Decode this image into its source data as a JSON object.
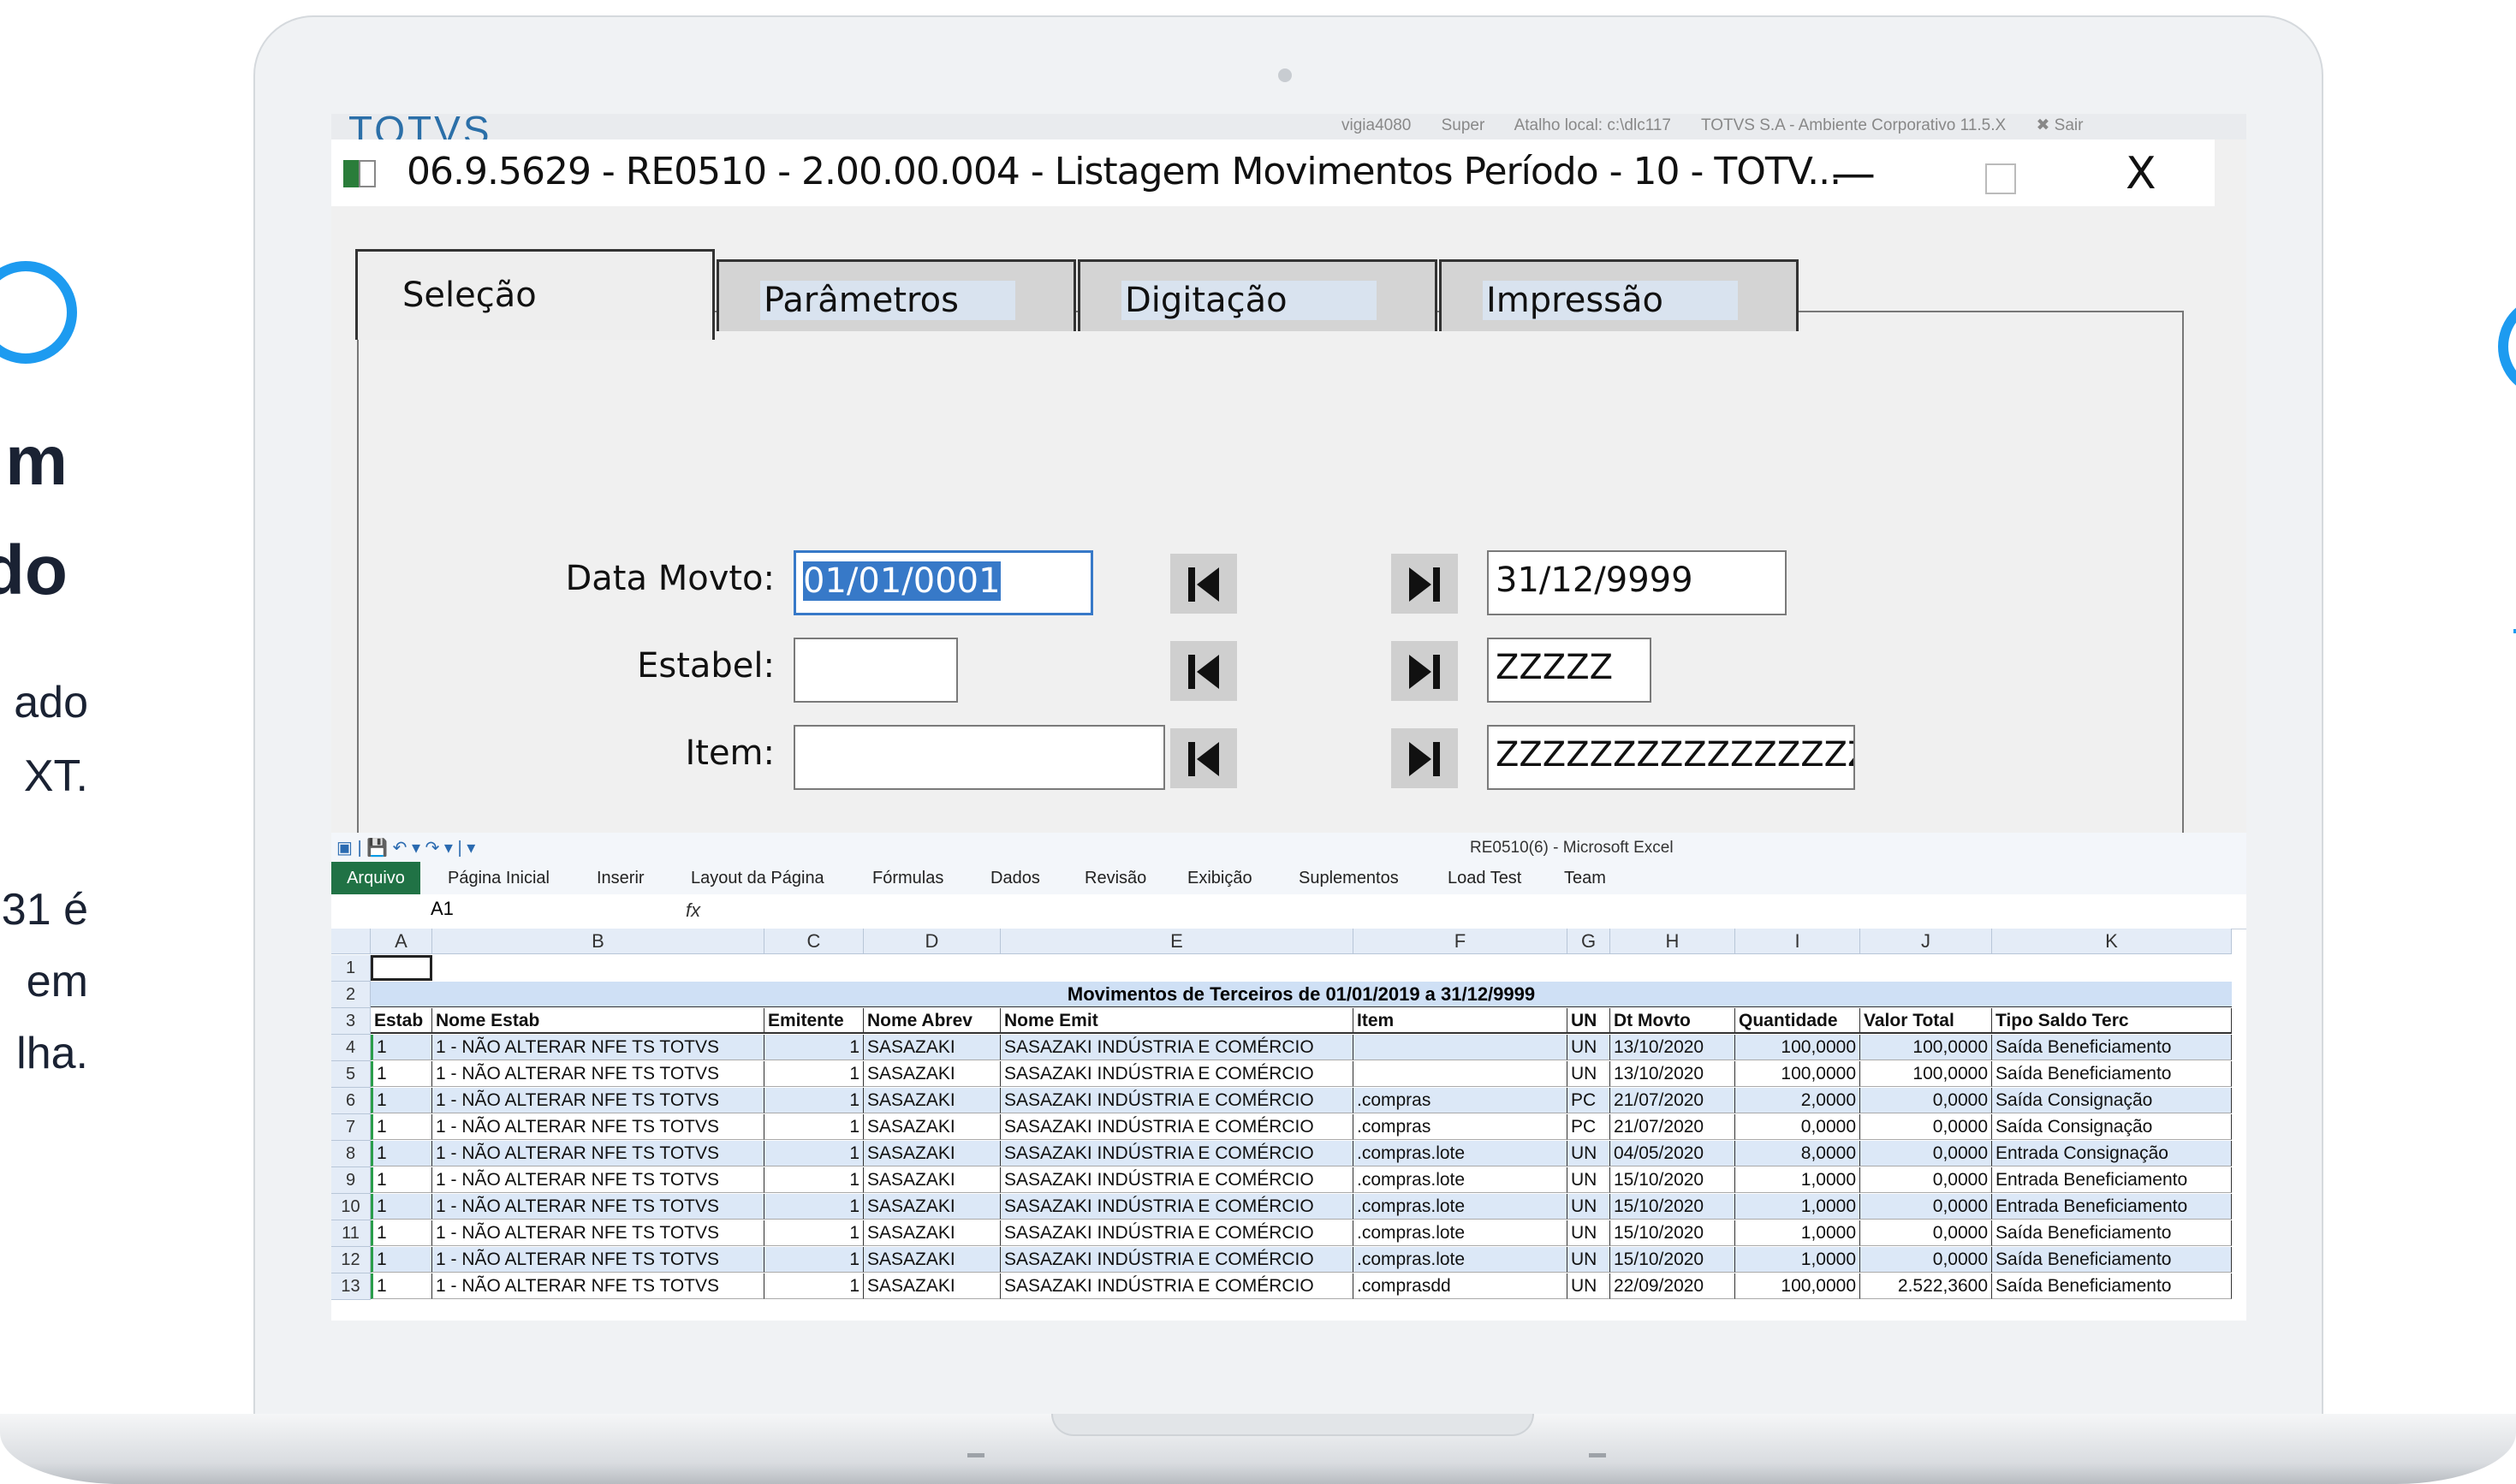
{
  "slide": {
    "left_big": [
      "m",
      "do"
    ],
    "left_small": [
      "ado",
      "XT.",
      "31 é",
      "em",
      "lha."
    ]
  },
  "bg_app": {
    "logo": "TOTVS",
    "topbar": [
      "vigia4080",
      "Super",
      "Atalho local: c:\\dlc117",
      "TOTVS S.A - Ambiente Corporativo 11.5.X",
      "✖ Sair"
    ]
  },
  "window": {
    "title": "06.9.5629 - RE0510 - 2.00.00.004 - Listagem Movimentos Período - 10 - TOTV...",
    "minimize": "—",
    "close": "X"
  },
  "tabs": [
    "Seleção",
    "Parâmetros",
    "Digitação",
    "Impressão"
  ],
  "selection": {
    "rows": [
      {
        "label": "Data Movto:",
        "from": "01/01/0001",
        "to": "31/12/9999"
      },
      {
        "label": "Estabel:",
        "from": "",
        "to": "ZZZZZ"
      },
      {
        "label": "Item:",
        "from": "",
        "to": "ZZZZZZZZZZZZZZZZ"
      }
    ]
  },
  "excel": {
    "title": "RE0510(6) - Microsoft Excel",
    "qat": "▣ | 💾 ↶ ▾ ↷ ▾ | ▾",
    "ribbon_tabs": [
      "Arquivo",
      "Página Inicial",
      "Inserir",
      "Layout da Página",
      "Fórmulas",
      "Dados",
      "Revisão",
      "Exibição",
      "Suplementos",
      "Load Test",
      "Team"
    ],
    "name_box": "A1",
    "fx": "fx",
    "columns": [
      "A",
      "B",
      "C",
      "D",
      "E",
      "F",
      "G",
      "H",
      "I",
      "J",
      "K"
    ],
    "report_title": "Movimentos de Terceiros de 01/01/2019 a 31/12/9999",
    "headers": [
      "Estab",
      "Nome Estab",
      "Emitente",
      "Nome Abrev",
      "Nome Emit",
      "Item",
      "UN",
      "Dt Movto",
      "Quantidade",
      "Valor Total",
      "Tipo Saldo Terc"
    ],
    "rows": [
      [
        "1",
        "1 - NÃO ALTERAR NFE TS TOTVS",
        "1",
        "SASAZAKI",
        "SASAZAKI INDÚSTRIA E COMÉRCIO",
        "",
        "UN",
        "13/10/2020",
        "100,0000",
        "100,0000",
        "Saída Beneficiamento"
      ],
      [
        "1",
        "1 - NÃO ALTERAR NFE TS TOTVS",
        "1",
        "SASAZAKI",
        "SASAZAKI INDÚSTRIA E COMÉRCIO",
        "",
        "UN",
        "13/10/2020",
        "100,0000",
        "100,0000",
        "Saída Beneficiamento"
      ],
      [
        "1",
        "1 - NÃO ALTERAR NFE TS TOTVS",
        "1",
        "SASAZAKI",
        "SASAZAKI INDÚSTRIA E COMÉRCIO",
        ".compras",
        "PC",
        "21/07/2020",
        "2,0000",
        "0,0000",
        "Saída Consignação"
      ],
      [
        "1",
        "1 - NÃO ALTERAR NFE TS TOTVS",
        "1",
        "SASAZAKI",
        "SASAZAKI INDÚSTRIA E COMÉRCIO",
        ".compras",
        "PC",
        "21/07/2020",
        "0,0000",
        "0,0000",
        "Saída Consignação"
      ],
      [
        "1",
        "1 - NÃO ALTERAR NFE TS TOTVS",
        "1",
        "SASAZAKI",
        "SASAZAKI INDÚSTRIA E COMÉRCIO",
        ".compras.lote",
        "UN",
        "04/05/2020",
        "8,0000",
        "0,0000",
        "Entrada Consignação"
      ],
      [
        "1",
        "1 - NÃO ALTERAR NFE TS TOTVS",
        "1",
        "SASAZAKI",
        "SASAZAKI INDÚSTRIA E COMÉRCIO",
        ".compras.lote",
        "UN",
        "15/10/2020",
        "1,0000",
        "0,0000",
        "Entrada Beneficiamento"
      ],
      [
        "1",
        "1 - NÃO ALTERAR NFE TS TOTVS",
        "1",
        "SASAZAKI",
        "SASAZAKI INDÚSTRIA E COMÉRCIO",
        ".compras.lote",
        "UN",
        "15/10/2020",
        "1,0000",
        "0,0000",
        "Entrada Beneficiamento"
      ],
      [
        "1",
        "1 - NÃO ALTERAR NFE TS TOTVS",
        "1",
        "SASAZAKI",
        "SASAZAKI INDÚSTRIA E COMÉRCIO",
        ".compras.lote",
        "UN",
        "15/10/2020",
        "1,0000",
        "0,0000",
        "Saída Beneficiamento"
      ],
      [
        "1",
        "1 - NÃO ALTERAR NFE TS TOTVS",
        "1",
        "SASAZAKI",
        "SASAZAKI INDÚSTRIA E COMÉRCIO",
        ".compras.lote",
        "UN",
        "15/10/2020",
        "1,0000",
        "0,0000",
        "Saída Beneficiamento"
      ],
      [
        "1",
        "1 - NÃO ALTERAR NFE TS TOTVS",
        "1",
        "SASAZAKI",
        "SASAZAKI INDÚSTRIA E COMÉRCIO",
        ".comprasdd",
        "UN",
        "22/09/2020",
        "100,0000",
        "2.522,3600",
        "Saída Beneficiamento"
      ]
    ]
  }
}
